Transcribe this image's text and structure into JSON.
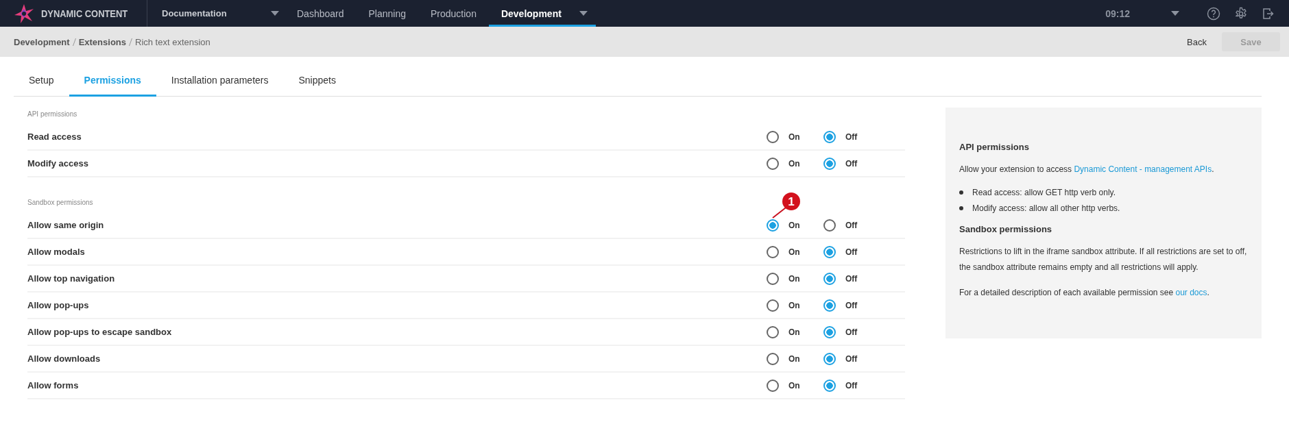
{
  "app": {
    "name": "DYNAMIC CONTENT",
    "hub": "Documentation",
    "nav": [
      {
        "label": "Dashboard",
        "selected": false,
        "dropdown": false
      },
      {
        "label": "Planning",
        "selected": false,
        "dropdown": false
      },
      {
        "label": "Production",
        "selected": false,
        "dropdown": false
      },
      {
        "label": "Development",
        "selected": true,
        "dropdown": true
      }
    ],
    "time": "09:12"
  },
  "breadcrumb": [
    {
      "label": "Development",
      "link": true
    },
    {
      "label": "Extensions",
      "link": true
    },
    {
      "label": "Rich text extension",
      "link": false
    }
  ],
  "actions": [
    {
      "label": "Back",
      "disabled": false,
      "kind": "text"
    },
    {
      "label": "Save",
      "disabled": true,
      "kind": "filled"
    }
  ],
  "tabs": [
    {
      "label": "Setup",
      "selected": false
    },
    {
      "label": "Permissions",
      "selected": true
    },
    {
      "label": "Installation parameters",
      "selected": false
    },
    {
      "label": "Snippets",
      "selected": false
    }
  ],
  "sections": [
    {
      "title": "API permissions",
      "rows": [
        {
          "label": "Read access",
          "options": [
            {
              "label": "On",
              "selected": false
            },
            {
              "label": "Off",
              "selected": true
            }
          ]
        },
        {
          "label": "Modify access",
          "options": [
            {
              "label": "On",
              "selected": false
            },
            {
              "label": "Off",
              "selected": true
            }
          ]
        }
      ]
    },
    {
      "title": "Sandbox permissions",
      "callout": "1",
      "rows": [
        {
          "label": "Allow same origin",
          "options": [
            {
              "label": "On",
              "selected": true
            },
            {
              "label": "Off",
              "selected": false
            }
          ]
        },
        {
          "label": "Allow modals",
          "options": [
            {
              "label": "On",
              "selected": false
            },
            {
              "label": "Off",
              "selected": true
            }
          ]
        },
        {
          "label": "Allow top navigation",
          "options": [
            {
              "label": "On",
              "selected": false
            },
            {
              "label": "Off",
              "selected": true
            }
          ]
        },
        {
          "label": "Allow pop-ups",
          "options": [
            {
              "label": "On",
              "selected": false
            },
            {
              "label": "Off",
              "selected": true
            }
          ]
        },
        {
          "label": "Allow pop-ups to escape sandbox",
          "options": [
            {
              "label": "On",
              "selected": false
            },
            {
              "label": "Off",
              "selected": true
            }
          ]
        },
        {
          "label": "Allow downloads",
          "options": [
            {
              "label": "On",
              "selected": false
            },
            {
              "label": "Off",
              "selected": true
            }
          ]
        },
        {
          "label": "Allow forms",
          "options": [
            {
              "label": "On",
              "selected": false
            },
            {
              "label": "Off",
              "selected": true
            }
          ]
        }
      ]
    }
  ],
  "help": {
    "api_title": "API permissions",
    "api_text": "Allow your extension to access ",
    "api_link": "Dynamic Content - management APIs",
    "api_text_end": ".",
    "bullets": [
      "Read access: allow GET http verb only.",
      "Modify access: allow all other http verbs."
    ],
    "sandbox_title": "Sandbox permissions",
    "sandbox_text": "Restrictions to lift in the iframe sandbox attribute. If all restrictions are set to off, the sandbox attribute remains empty and all restrictions will apply.",
    "docs_text": "For a detailed description of each available permission see ",
    "docs_link": "our docs",
    "docs_text_end": "."
  }
}
